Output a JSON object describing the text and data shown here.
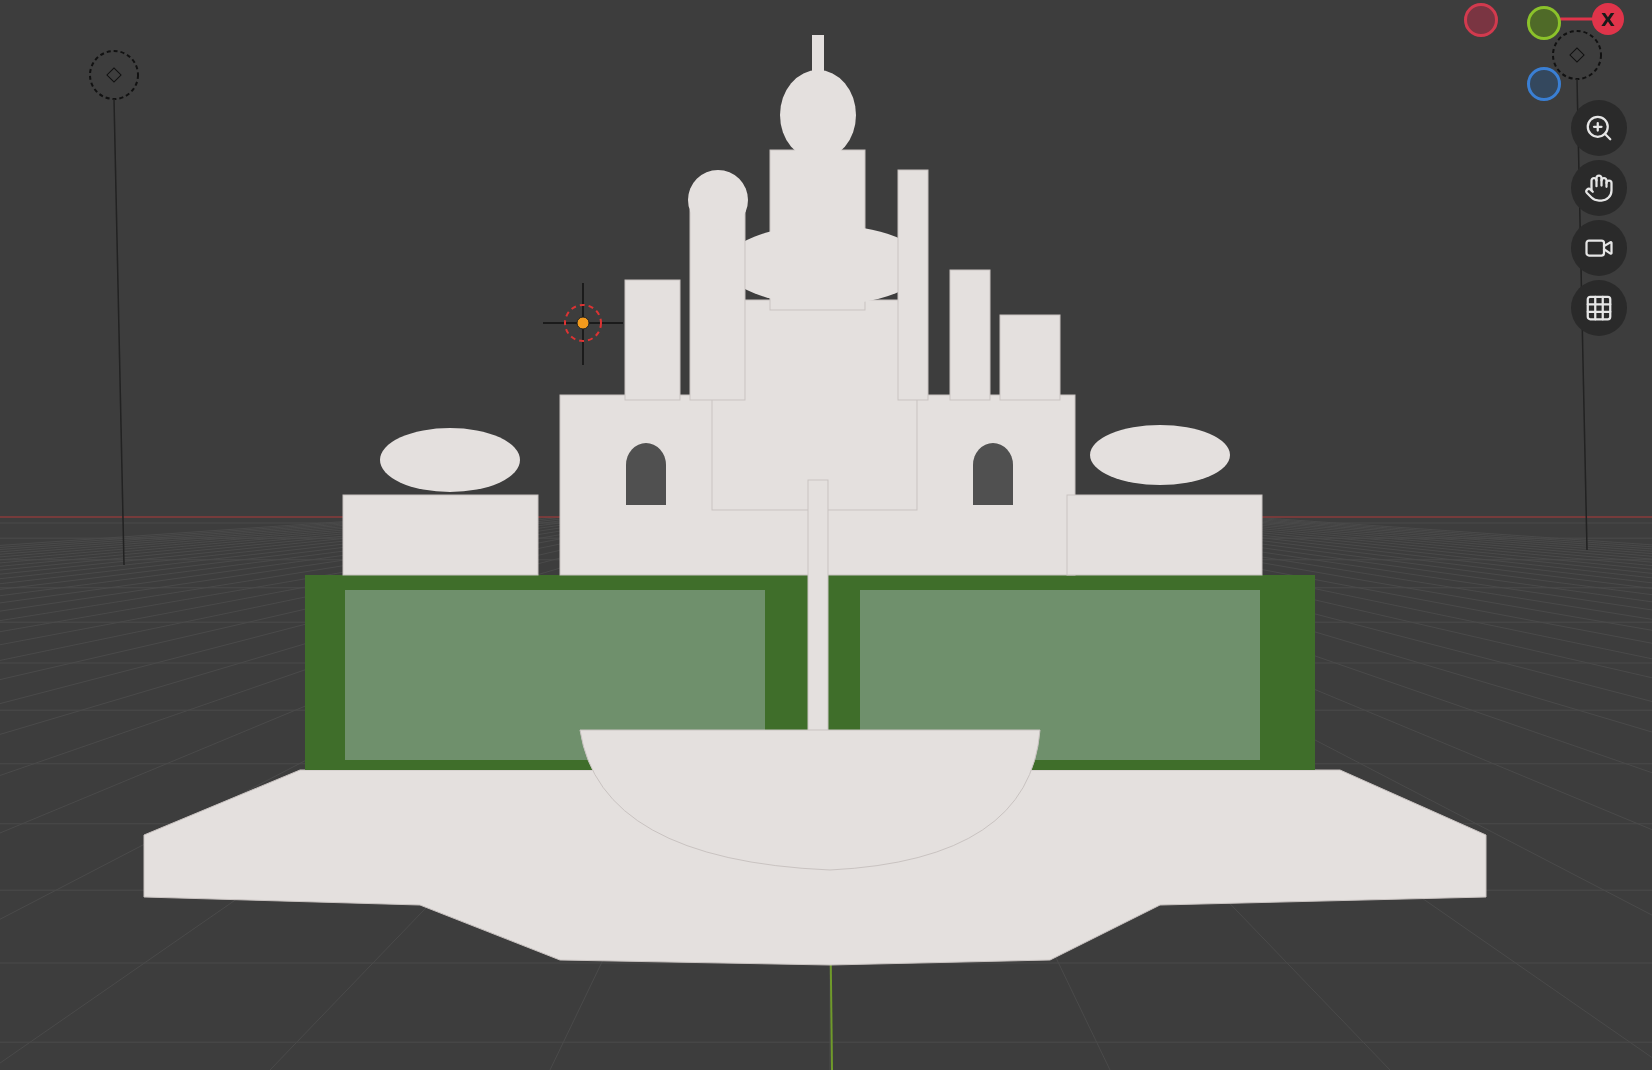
{
  "axis_gizmo": {
    "x_label": "X"
  },
  "nav_buttons": [
    {
      "kind": "zoom"
    },
    {
      "kind": "pan"
    },
    {
      "kind": "camera"
    },
    {
      "kind": "perspective"
    }
  ]
}
